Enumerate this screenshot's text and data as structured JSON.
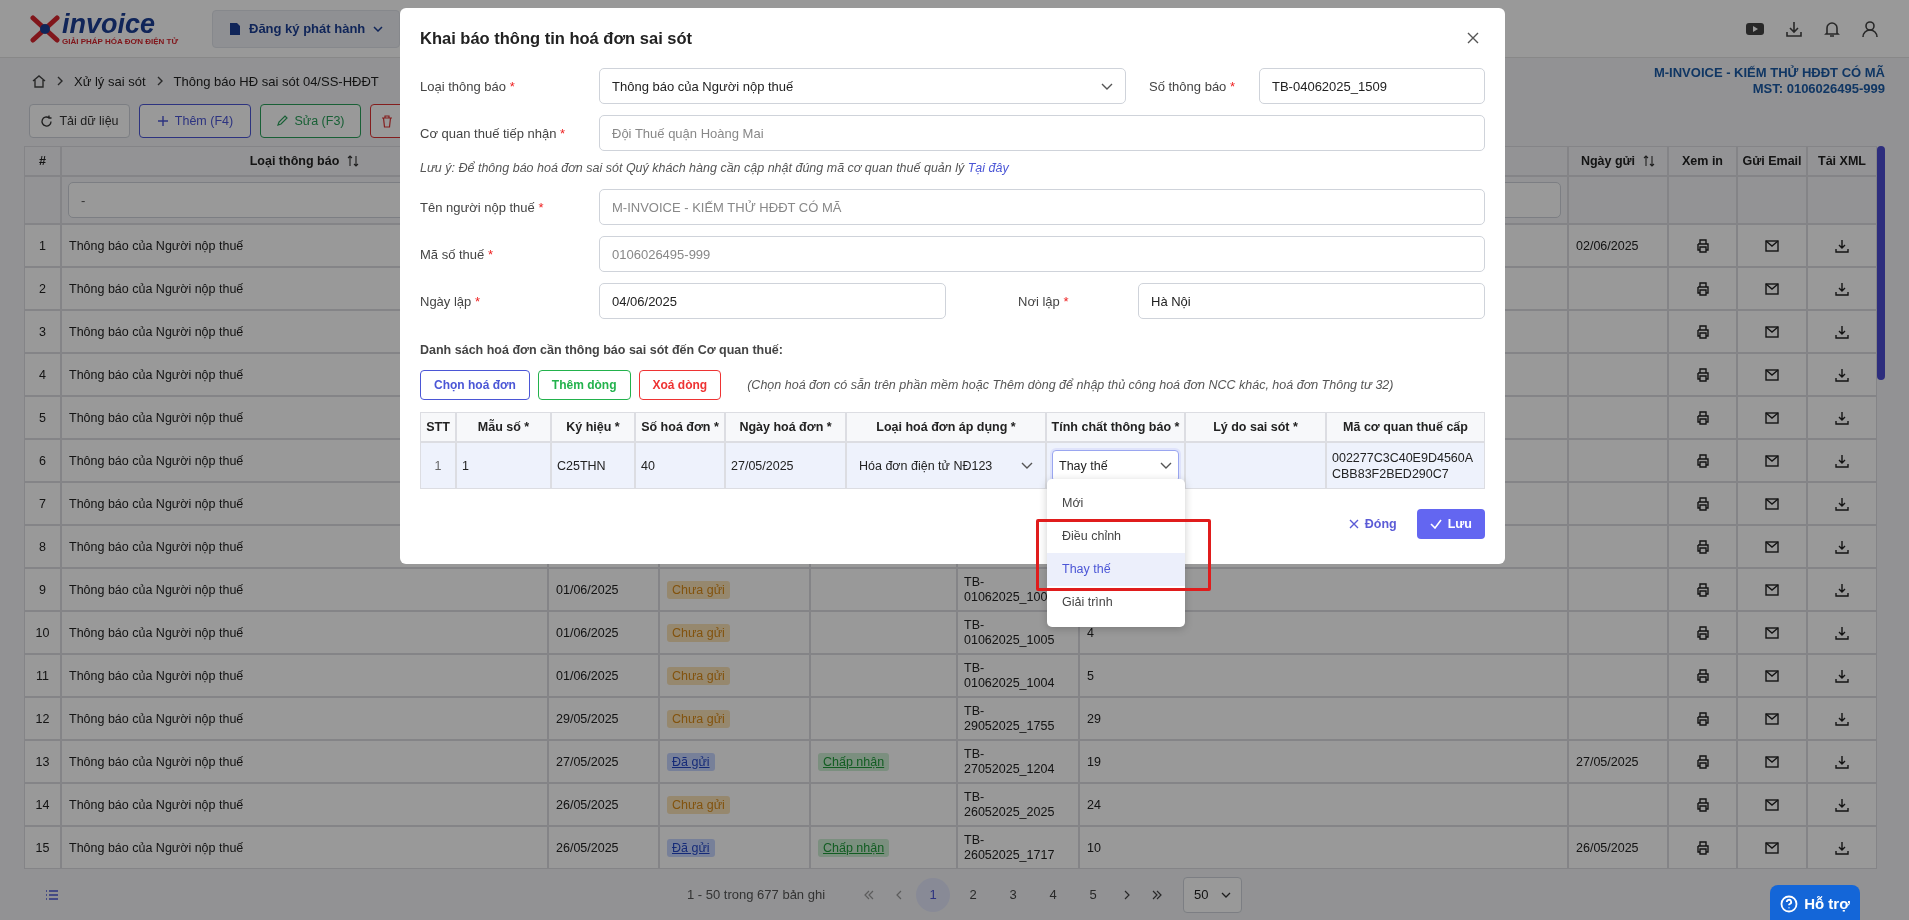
{
  "header": {
    "logo_text": "invoice",
    "logo_tagline": "GIẢI PHÁP HÓA ĐƠN ĐIỆN TỬ",
    "nav": [
      {
        "label": "Đăng ký phát hành"
      }
    ]
  },
  "breadcrumb": [
    "Xử lý sai sót",
    "Thông báo HĐ sai sót 04/SS-HĐĐT"
  ],
  "company": {
    "name": "M-INVOICE - KIẾM THỬ HĐĐT CÓ MÃ",
    "tax_code": "MST: 0106026495-999"
  },
  "toolbar": [
    {
      "kind": "reload",
      "label": "Tải dữ liệu"
    },
    {
      "kind": "add",
      "label": "Thêm (F4)"
    },
    {
      "kind": "edit",
      "label": "Sửa (F3)"
    },
    {
      "kind": "delete"
    }
  ],
  "table": {
    "columns": [
      {
        "label": "#",
        "sortable": false
      },
      {
        "label": "Loại thông báo",
        "sortable": true
      },
      {
        "label": "Ngày gửi",
        "sortable": true
      },
      {
        "label": "Xem in",
        "sortable": false
      },
      {
        "label": "Gửi Email",
        "sortable": false
      },
      {
        "label": "Tải XML",
        "sortable": false
      }
    ],
    "filter": "-",
    "rows": [
      {
        "no": "1",
        "type": "Thông báo của Người nộp thuế",
        "sent_date": "02/06/2025"
      },
      {
        "no": "2",
        "type": "Thông báo của Người nộp thuế"
      },
      {
        "no": "3",
        "type": "Thông báo của Người nộp thuế"
      },
      {
        "no": "4",
        "type": "Thông báo của Người nộp thuế"
      },
      {
        "no": "5",
        "type": "Thông báo của Người nộp thuế"
      },
      {
        "no": "6",
        "type": "Thông báo của Người nộp thuế"
      },
      {
        "no": "7",
        "type": "Thông báo của Người nộp thuế"
      },
      {
        "no": "8",
        "type": "Thông báo của Người nộp thuế"
      },
      {
        "no": "9",
        "type": "Thông báo của Người nộp thuế",
        "date": "01/06/2025",
        "status": {
          "kind": "pending",
          "text": "Chưa gửi"
        },
        "notice_no": "TB-01062025_100"
      },
      {
        "no": "10",
        "type": "Thông báo của Người nộp thuế",
        "date": "01/06/2025",
        "status": {
          "kind": "pending",
          "text": "Chưa gửi"
        },
        "notice_no": "TB-01062025_1005",
        "column_7": "4"
      },
      {
        "no": "11",
        "type": "Thông báo của Người nộp thuế",
        "date": "01/06/2025",
        "status": {
          "kind": "pending",
          "text": "Chưa gửi"
        },
        "notice_no": "TB-01062025_1004",
        "column_7": "5"
      },
      {
        "no": "12",
        "type": "Thông báo của Người nộp thuế",
        "date": "29/05/2025",
        "status": {
          "kind": "pending",
          "text": "Chưa gửi"
        },
        "notice_no": "TB-29052025_1755",
        "column_7": "29"
      },
      {
        "no": "13",
        "type": "Thông báo của Người nộp thuế",
        "date": "27/05/2025",
        "status": {
          "kind": "sent",
          "text": "Đã gửi"
        },
        "tax_status": {
          "kind": "accepted",
          "text": "Chấp nhận"
        },
        "notice_no": "TB-27052025_1204",
        "column_7": "19",
        "sent_date": "27/05/2025"
      },
      {
        "no": "14",
        "type": "Thông báo của Người nộp thuế",
        "date": "26/05/2025",
        "status": {
          "kind": "pending",
          "text": "Chưa gửi"
        },
        "notice_no": "TB-26052025_2025",
        "column_7": "24"
      },
      {
        "no": "15",
        "type": "Thông báo của Người nộp thuế",
        "date": "26/05/2025",
        "status": {
          "kind": "sent",
          "text": "Đã gửi"
        },
        "tax_status": {
          "kind": "accepted",
          "text": "Chấp nhận"
        },
        "notice_no": "TB-26052025_1717",
        "column_7": "10",
        "sent_date": "26/05/2025"
      }
    ]
  },
  "pagination": {
    "summary": "1 - 50 trong 677 bản ghi",
    "pages": [
      {
        "label": "1",
        "selected": true
      },
      {
        "label": "2",
        "selected": false
      },
      {
        "label": "3",
        "selected": false
      },
      {
        "label": "4",
        "selected": false
      },
      {
        "label": "5",
        "selected": false
      }
    ],
    "page_size": "50"
  },
  "help_button": "Hỗ trợ",
  "dialog": {
    "title": "Khai báo thông tin hoá đơn sai sót",
    "form": [
      {
        "kind": "split_right",
        "fields": [
          {
            "label": "Loại thông báo",
            "required_mark": "*",
            "kind": "select",
            "value": "Thông báo của Người nộp thuế",
            "disabled": false
          },
          {
            "label": "Số thông báo",
            "required_mark": "*",
            "kind": "text",
            "value": "TB-04062025_1509",
            "disabled": false
          }
        ]
      },
      {
        "kind": "single",
        "fields": [
          {
            "label": "Cơ quan thuế tiếp nhận",
            "required_mark": "*",
            "kind": "text",
            "value": "Đội Thuế quận Hoàng Mai",
            "disabled": true
          }
        ]
      },
      {
        "kind": "note",
        "text": "Lưu ý: Để thông báo hoá đơn sai sót Quý khách hàng cần cập nhật đúng mã cơ quan thuế quản lý",
        "link": "Tại đây"
      },
      {
        "kind": "single",
        "fields": [
          {
            "label": "Tên người nộp thuế",
            "required_mark": "*",
            "kind": "text",
            "value": "M-INVOICE - KIẾM THỬ HĐĐT CÓ MÃ",
            "disabled": true
          }
        ]
      },
      {
        "kind": "single",
        "fields": [
          {
            "label": "Mã số thuế",
            "required_mark": "*",
            "kind": "text",
            "value": "0106026495-999",
            "disabled": true
          }
        ]
      },
      {
        "kind": "split_half",
        "fields": [
          {
            "label": "Ngày lập",
            "required_mark": "*",
            "kind": "text",
            "value": "04/06/2025",
            "disabled": false
          },
          {
            "label": "Nơi lập",
            "required_mark": "*",
            "kind": "text",
            "value": "Hà Nội",
            "disabled": false
          }
        ]
      }
    ],
    "section_title": "Danh sách hoá đơn cần thông báo sai sót đến Cơ quan thuế:",
    "actions": [
      {
        "kind": "choose",
        "label": "Chọn hoá đơn"
      },
      {
        "kind": "add",
        "label": "Thêm dòng"
      },
      {
        "kind": "remove",
        "label": "Xoá dòng"
      }
    ],
    "hint": "(Chọn hoá đơn có sẵn trên phần mềm hoặc Thêm dòng để nhập thủ công hoá đơn NCC khác, hoá đơn Thông tư 32)",
    "invoice_table": {
      "columns": [
        "STT",
        "Mẫu số *",
        "Ký hiệu *",
        "Số hoá đơn *",
        "Ngày hoá đơn *",
        "Loại hoá đơn áp dụng *",
        "Tính chất thông báo *",
        "Lý do sai sót *",
        "Mã cơ quan thuế cấp"
      ],
      "rows": [
        {
          "cells": [
            {
              "kind": "index",
              "value": "1"
            },
            {
              "kind": "text",
              "value": "1"
            },
            {
              "kind": "text",
              "value": "C25THN"
            },
            {
              "kind": "text",
              "value": "40"
            },
            {
              "kind": "text",
              "value": "27/05/2025"
            },
            {
              "kind": "select",
              "value": "Hóa đơn điện tử NĐ123",
              "open": false
            },
            {
              "kind": "select",
              "value": "Thay thế",
              "open": true,
              "options": [
                {
                  "label": "Mới",
                  "selected": false
                },
                {
                  "label": "Điều chỉnh",
                  "selected": false
                },
                {
                  "label": "Thay thế",
                  "selected": true
                },
                {
                  "label": "Giải trình",
                  "selected": false
                }
              ]
            },
            {
              "kind": "text"
            },
            {
              "kind": "text",
              "value": "002277C3C40E9D4560ACBB83F2BED290C7"
            }
          ]
        }
      ]
    },
    "buttons": [
      {
        "kind": "close",
        "label": "Đóng"
      },
      {
        "kind": "save",
        "label": "Lưu"
      }
    ]
  }
}
